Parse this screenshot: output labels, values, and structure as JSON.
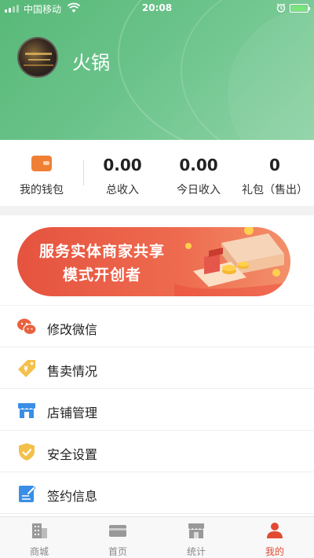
{
  "status_bar": {
    "carrier": "中国移动",
    "time": "20:08"
  },
  "profile": {
    "username": "火锅"
  },
  "stats": [
    {
      "label": "我的钱包",
      "icon": "wallet-icon"
    },
    {
      "value": "0.00",
      "label": "总收入"
    },
    {
      "value": "0.00",
      "label": "今日收入"
    },
    {
      "value": "0",
      "label": "礼包（售出）"
    }
  ],
  "banner": {
    "line1": "服务实体商家共享",
    "line2": "模式开创者"
  },
  "menu": [
    {
      "label": "修改微信",
      "icon": "wechat-icon"
    },
    {
      "label": "售卖情况",
      "icon": "price-tag-icon"
    },
    {
      "label": "店铺管理",
      "icon": "store-icon"
    },
    {
      "label": "安全设置",
      "icon": "shield-icon"
    },
    {
      "label": "签约信息",
      "icon": "contract-icon"
    }
  ],
  "tabbar": [
    {
      "label": "商城",
      "icon": "building-icon"
    },
    {
      "label": "首页",
      "icon": "card-icon"
    },
    {
      "label": "统计",
      "icon": "shop-icon"
    },
    {
      "label": "我的",
      "icon": "user-icon",
      "active": true
    }
  ],
  "colors": {
    "header_green": "#5fbd80",
    "accent_red": "#e24a33",
    "banner_red": "#e5533f",
    "wallet_orange": "#f07f36"
  }
}
